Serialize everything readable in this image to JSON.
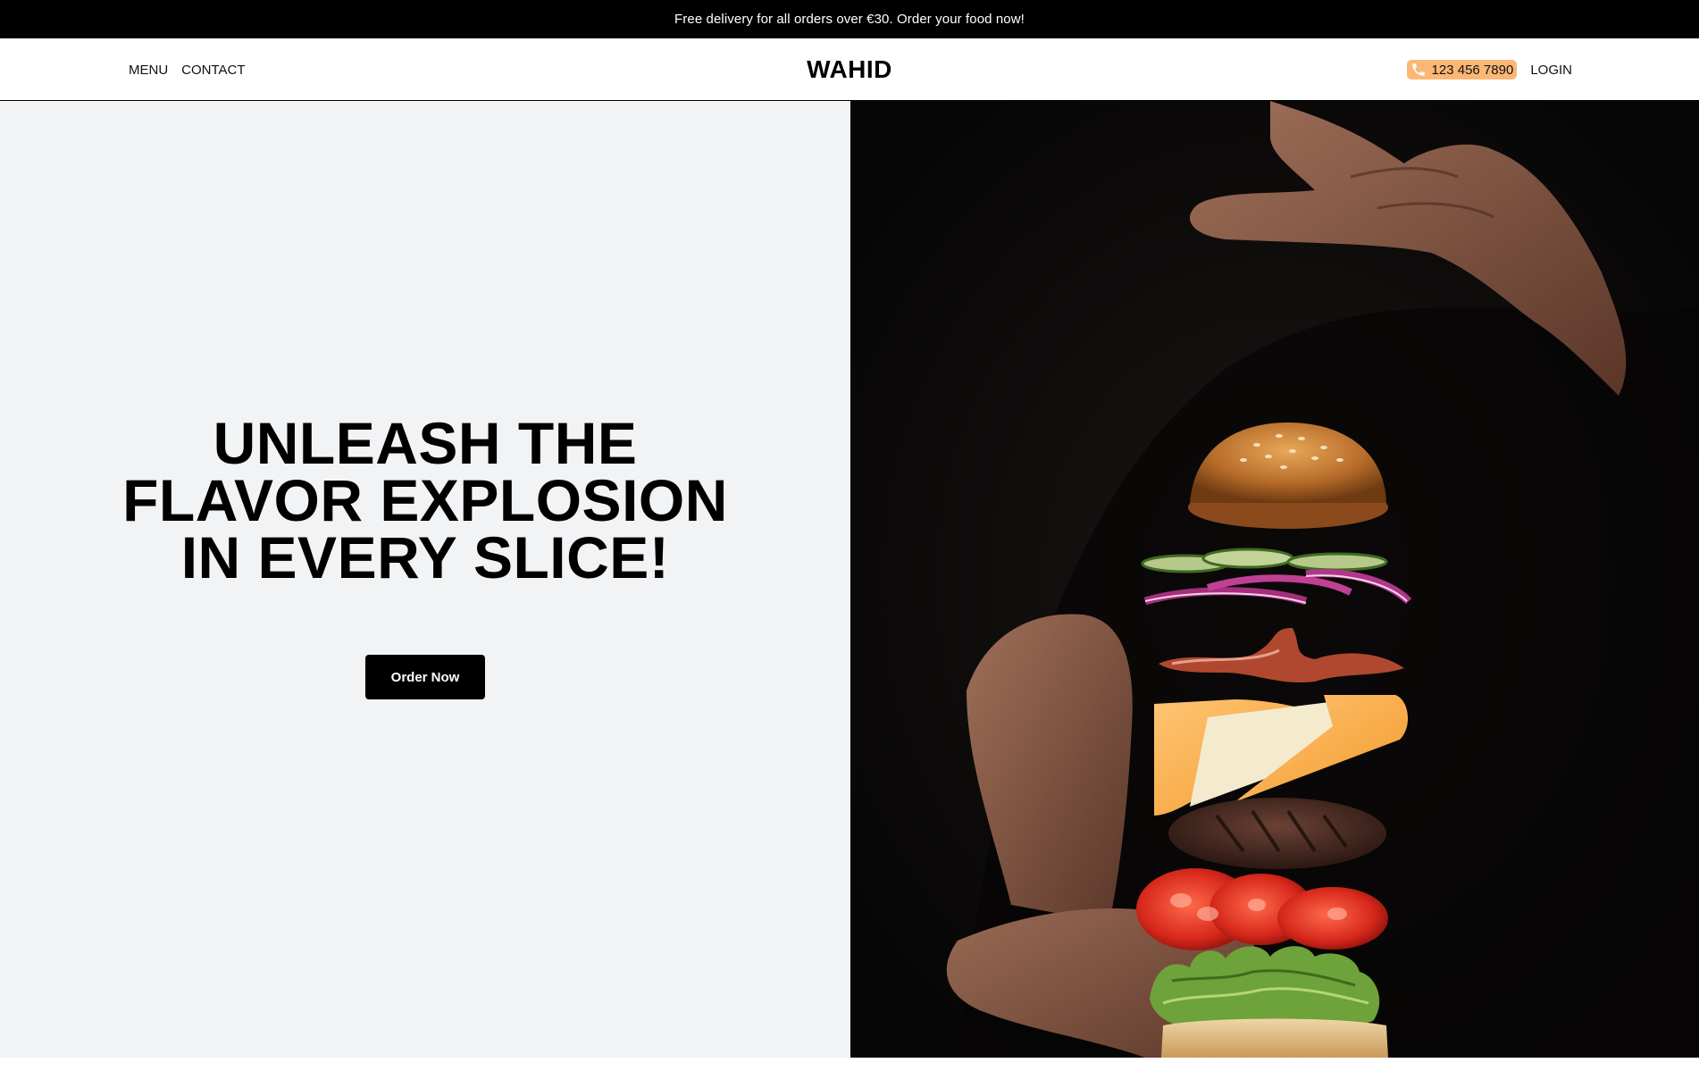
{
  "announcement": {
    "text": "Free delivery for all orders over €30. Order your food now!"
  },
  "nav": {
    "menu_label": "MENU",
    "contact_label": "CONTACT",
    "brand": "WAHID",
    "phone": "123 456 7890",
    "login_label": "LOGIN"
  },
  "hero": {
    "title": "UNLEASH THE FLAVOR EXPLOSION IN EVERY SLICE!",
    "cta_label": "Order Now",
    "image": "burger-ingredients-floating-between-hands"
  },
  "colors": {
    "topbar_bg": "#000000",
    "phone_pill_bg": "#fbb776",
    "hero_left_bg": "#f2f3f5",
    "cta_bg": "#000000",
    "photo_bg": "#0c0a09"
  },
  "icons": {
    "phone": "phone-icon"
  }
}
